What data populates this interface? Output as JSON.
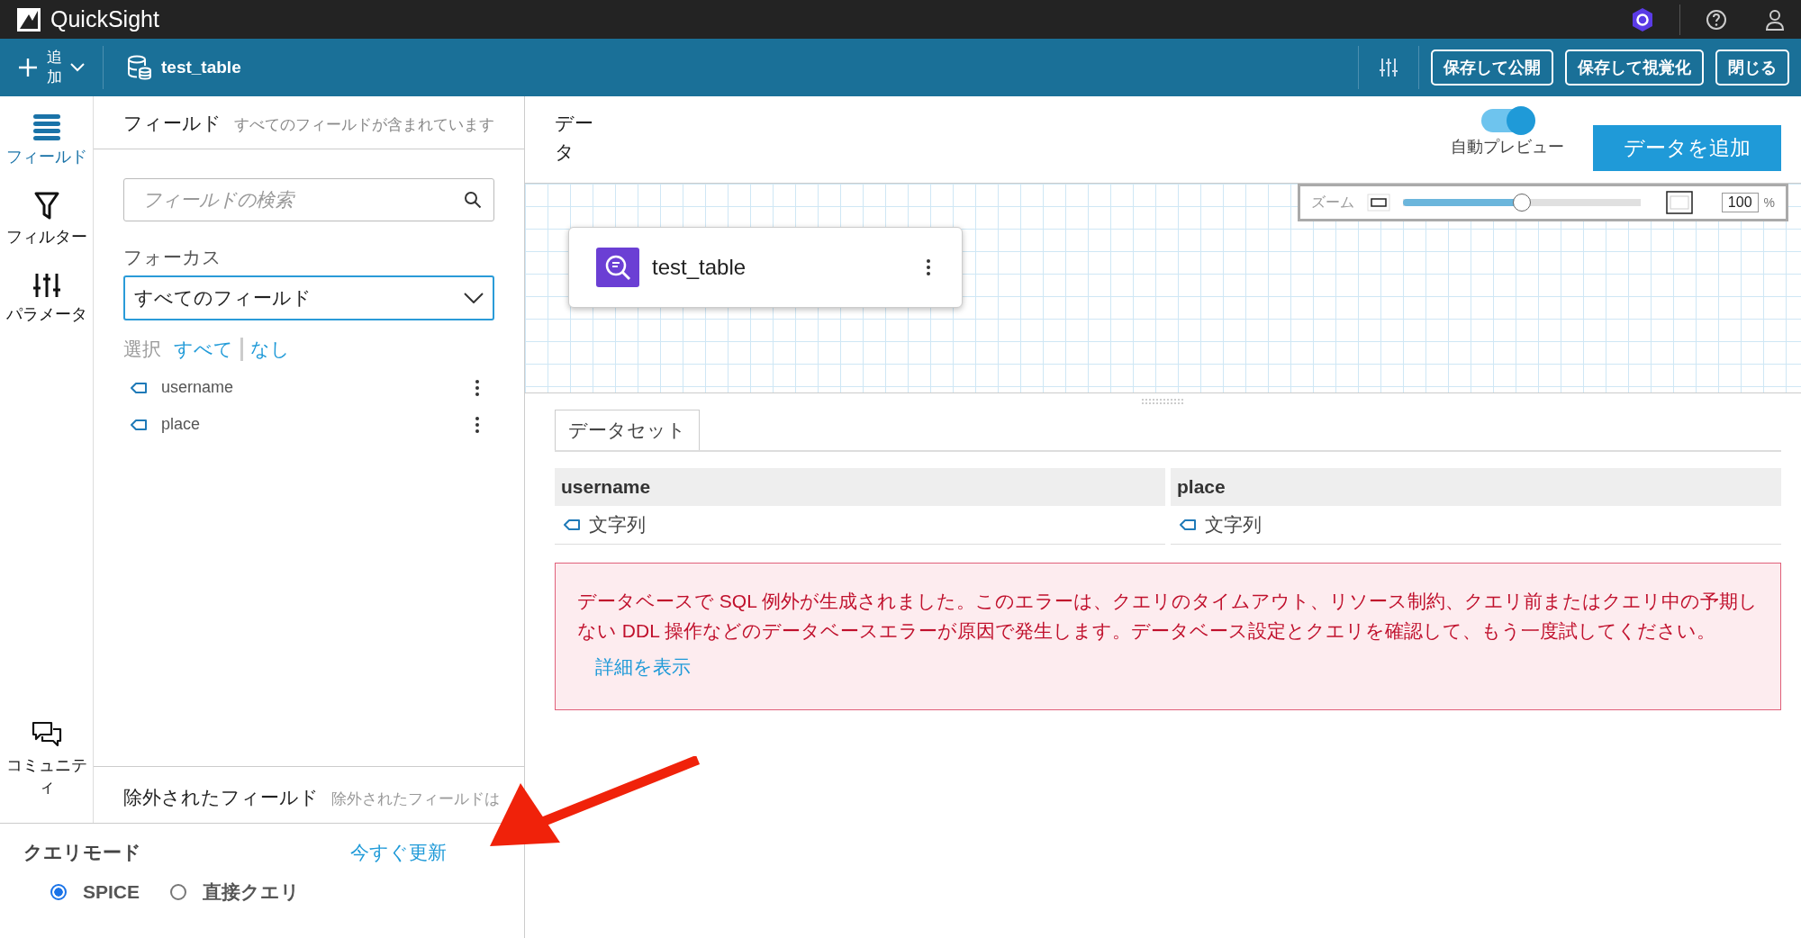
{
  "app_bar": {
    "title": "QuickSight"
  },
  "toolbar": {
    "add_label": "追加",
    "dataset_name": "test_table",
    "buttons": [
      "保存して公開",
      "保存して視覚化",
      "閉じる"
    ]
  },
  "rail": [
    {
      "label": "フィールド",
      "kind": "fields",
      "selected": true
    },
    {
      "label": "フィルター",
      "kind": "filter",
      "selected": false
    },
    {
      "label": "パラメータ",
      "kind": "params",
      "selected": false
    },
    {
      "label": "コミュニティ",
      "kind": "community",
      "selected": false
    }
  ],
  "fields_panel": {
    "title": "フィールド",
    "subtitle": "すべてのフィールドが含まれています",
    "search": {
      "placeholder": "フィールドの検索"
    },
    "focus_label": "フォーカス",
    "focus_value": "すべてのフィールド",
    "select_label": "選択",
    "select_all": "すべて",
    "select_none": "なし",
    "fields": [
      {
        "name": "username"
      },
      {
        "name": "place"
      }
    ],
    "excluded_title": "除外されたフィールド",
    "excluded_hint": "除外されたフィールドは"
  },
  "query_mode": {
    "title": "クエリモード",
    "refresh_link": "今すぐ更新",
    "options": [
      {
        "label": "SPICE",
        "selected": true
      },
      {
        "label": "直接クエリ",
        "selected": false
      }
    ]
  },
  "data_header": {
    "title": "データ",
    "auto_preview": {
      "label": "自動プレビュー",
      "on": true
    },
    "add_button": "データを追加"
  },
  "zoom": {
    "label": "ズーム",
    "level": 0.5,
    "value": "100",
    "unit": "%"
  },
  "nodes": [
    {
      "name": "test_table"
    }
  ],
  "dataset": {
    "tabs": [
      {
        "label": "データセット",
        "selected": true
      }
    ],
    "columns": [
      {
        "name": "username",
        "type": "文字列"
      },
      {
        "name": "place",
        "type": "文字列"
      }
    ]
  },
  "error": {
    "message": "データベースで SQL 例外が生成されました。このエラーは、クエリのタイムアウト、リソース制約、クエリ前またはクエリ中の予期しない DDL 操作などのデータベースエラーが原因で発生します。データベース設定とクエリを確認して、もう一度試してください。",
    "link": "詳細を表示"
  }
}
